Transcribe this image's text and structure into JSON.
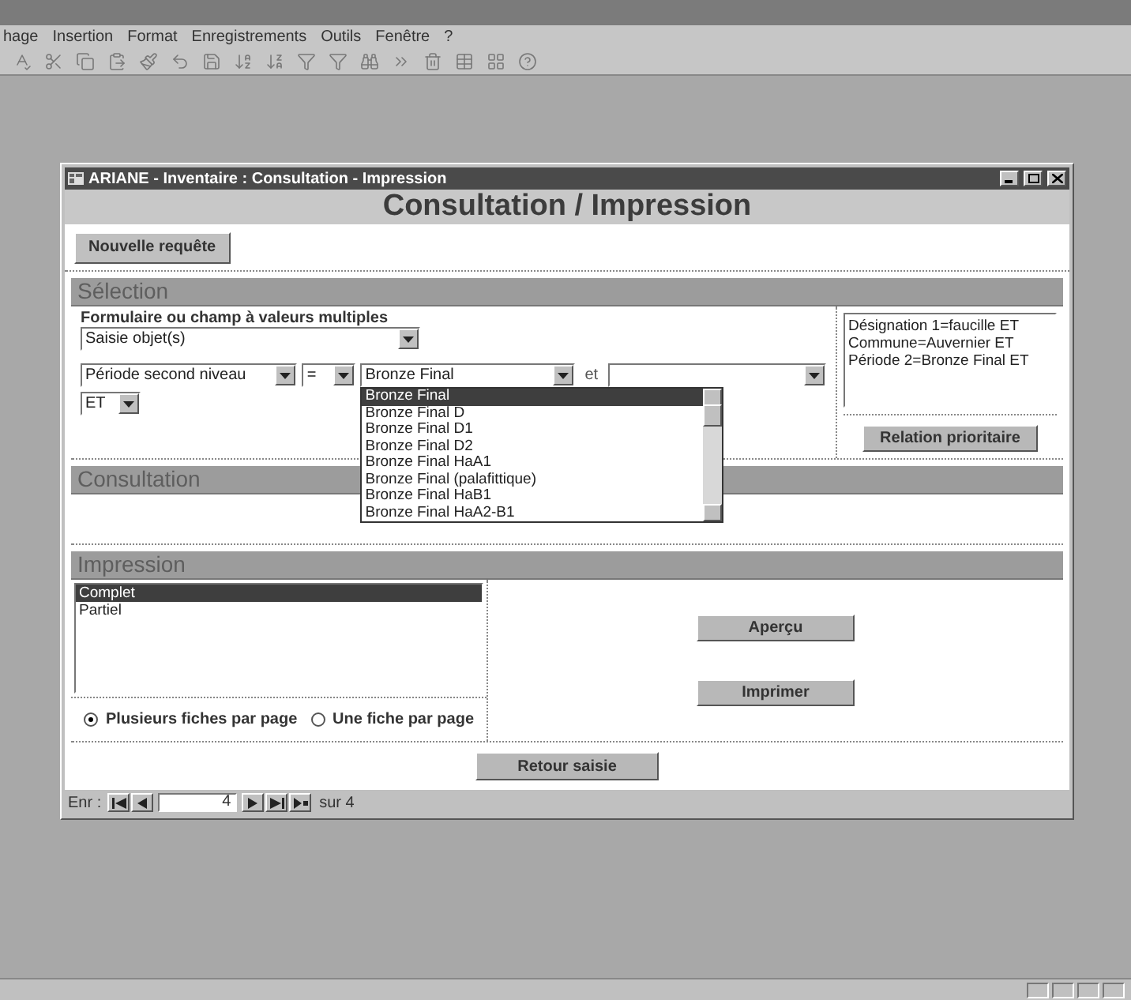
{
  "menu_bar": [
    "hage",
    "Insertion",
    "Format",
    "Enregistrements",
    "Outils",
    "Fenêtre",
    "?"
  ],
  "window": {
    "title": "ARIANE - Inventaire : Consultation - Impression"
  },
  "header": "Consultation / Impression",
  "new_query_button": "Nouvelle requête",
  "selection": {
    "title": "Sélection",
    "form_label": "Formulaire ou champ à valeurs multiples",
    "form_combo": "Saisie objet(s)",
    "field_combo": "Période second niveau",
    "operator_combo": "=",
    "value_combo": "Bronze Final",
    "and_label": "et",
    "connector_combo": "ET",
    "dropdown": [
      {
        "label": "Bronze Final",
        "selected": true
      },
      {
        "label": "Bronze Final D",
        "selected": false
      },
      {
        "label": "Bronze Final D1",
        "selected": false
      },
      {
        "label": "Bronze Final D2",
        "selected": false
      },
      {
        "label": "Bronze Final HaA1",
        "selected": false
      },
      {
        "label": "Bronze Final (palafittique)",
        "selected": false
      },
      {
        "label": "Bronze Final HaB1",
        "selected": false
      },
      {
        "label": "Bronze Final HaA2-B1",
        "selected": false
      }
    ],
    "summary_lines": [
      "Désignation 1=faucille ET",
      "Commune=Auvernier ET",
      "Période 2=Bronze Final ET"
    ],
    "priority_button": "Relation prioritaire"
  },
  "consultation": {
    "title": "Consultation"
  },
  "impression": {
    "title": "Impression",
    "list": [
      {
        "label": "Complet",
        "selected": true
      },
      {
        "label": "Partiel",
        "selected": false
      }
    ],
    "options": [
      {
        "label": "Plusieurs fiches par page",
        "selected": true
      },
      {
        "label": "Une fiche par page",
        "selected": false
      }
    ],
    "buttons": [
      "Aperçu",
      "Imprimer"
    ]
  },
  "back_button": "Retour saisie",
  "record_nav": {
    "label": "Enr :",
    "current": "4",
    "total": "sur 4"
  }
}
